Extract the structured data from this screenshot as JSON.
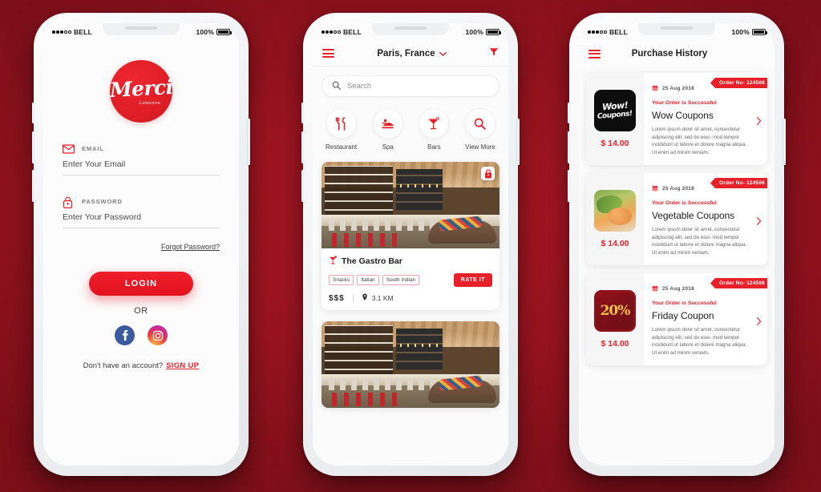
{
  "theme": {
    "accent": "#e8202a",
    "background": "#9c1420",
    "screen_bg": "#fcfcfc"
  },
  "status_bar": {
    "carrier": "BELL",
    "battery": "100%"
  },
  "screen_login": {
    "logo": {
      "word": "Merci",
      "sub": "Lebanon"
    },
    "email": {
      "label": "EMAIL",
      "placeholder": "Enter Your Email",
      "value": "",
      "icon": "envelope-icon"
    },
    "password": {
      "label": "PASSWORD",
      "placeholder": "Enter Your Password",
      "value": "",
      "icon": "lock-icon"
    },
    "forgot_password": "Forgot Password?",
    "login_button": "LOGIN",
    "or_divider": "OR",
    "socials": [
      {
        "name": "facebook",
        "icon": "facebook-icon"
      },
      {
        "name": "instagram",
        "icon": "instagram-icon"
      }
    ],
    "signup_prompt": "Don't have an account?",
    "signup_link": "SIGN UP"
  },
  "screen_listing": {
    "menu_icon": "hamburger-menu-icon",
    "location": "Paris, France",
    "location_chevron": "chevron-down-icon",
    "filter_icon": "filter-funnel-icon",
    "search": {
      "placeholder": "Search",
      "value": "",
      "icon": "search-icon"
    },
    "categories": [
      {
        "label": "Restaurant",
        "icon": "cutlery-icon"
      },
      {
        "label": "Spa",
        "icon": "massage-icon"
      },
      {
        "label": "Bars",
        "icon": "cocktail-icon"
      },
      {
        "label": "View More",
        "icon": "search-icon"
      }
    ],
    "restaurant": {
      "name": "The Gastro Bar",
      "title_icon": "cocktail-icon",
      "lock_icon": "lock-icon",
      "tags": [
        "Snacks",
        "Italian",
        "South Indian"
      ],
      "rate_button": "RATE IT",
      "price_level": "$$$",
      "distance": "3.1 KM",
      "distance_icon": "location-pin-icon"
    }
  },
  "screen_history": {
    "menu_icon": "hamburger-menu-icon",
    "title": "Purchase History",
    "cards": [
      {
        "date": "25 Aug 2018",
        "date_icon": "calendar-icon",
        "order_no": "Order No- 124566",
        "status": "Your Order is Successful",
        "title": "Wow Coupons",
        "description": "Lorem ipsum dolor sit amet, consectetur adipiscing elit, sed do eius- mod tempor incididunt ut labore et dolore magna aliqua. Ut enim ad minim veniam.",
        "price": "$ 14.00",
        "thumb": "wow-coupons-thumbnail",
        "thumb_text_1": "Wow!",
        "thumb_text_2": "Coupons!",
        "arrow_icon": "chevron-right-icon"
      },
      {
        "date": "25 Aug 2018",
        "date_icon": "calendar-icon",
        "order_no": "Order No- 124566",
        "status": "Your Order is Successful",
        "title": "Vegetable Coupons",
        "description": "Lorem ipsum dolor sit amet, consectetur adipiscing elit, sed do eius- mod tempor incididunt ut labore et dolore magna aliqua. Ut enim ad minim veniam.",
        "price": "$ 14.00",
        "thumb": "vegetable-dish-thumbnail",
        "arrow_icon": "chevron-right-icon"
      },
      {
        "date": "25 Aug 2018",
        "date_icon": "calendar-icon",
        "order_no": "Order No- 124566",
        "status": "Your Order is Successful",
        "title": "Friday Coupon",
        "description": "Lorem ipsum dolor sit amet, consectetur adipiscing elit, sed do eius- mod tempor incididunt ut labore et dolore magna aliqua. Ut enim ad minim veniam.",
        "price": "$ 14.00",
        "thumb": "twenty-percent-coupon-thumbnail",
        "thumb_text_1": "20%",
        "arrow_icon": "chevron-right-icon"
      }
    ]
  }
}
